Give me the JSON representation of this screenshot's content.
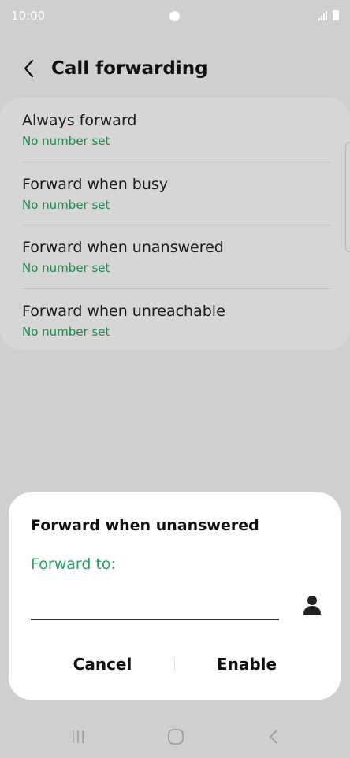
{
  "status_bar": {
    "time": "10:00"
  },
  "header": {
    "title": "Call forwarding"
  },
  "list": {
    "items": [
      {
        "title": "Always forward",
        "subtitle": "No number set"
      },
      {
        "title": "Forward when busy",
        "subtitle": "No number set"
      },
      {
        "title": "Forward when unanswered",
        "subtitle": "No number set"
      },
      {
        "title": "Forward when unreachable",
        "subtitle": "No number set"
      }
    ]
  },
  "dialog": {
    "title": "Forward when unanswered",
    "field_label": "Forward to:",
    "field_value": "",
    "cancel_label": "Cancel",
    "enable_label": "Enable"
  },
  "colors": {
    "accent_green": "#22a35e",
    "subtitle_green": "#1e8a4e",
    "background": "#cfcfcf"
  },
  "icons": [
    "back-arrow-icon",
    "contact-person-icon",
    "recents-icon",
    "home-icon",
    "nav-back-icon"
  ]
}
